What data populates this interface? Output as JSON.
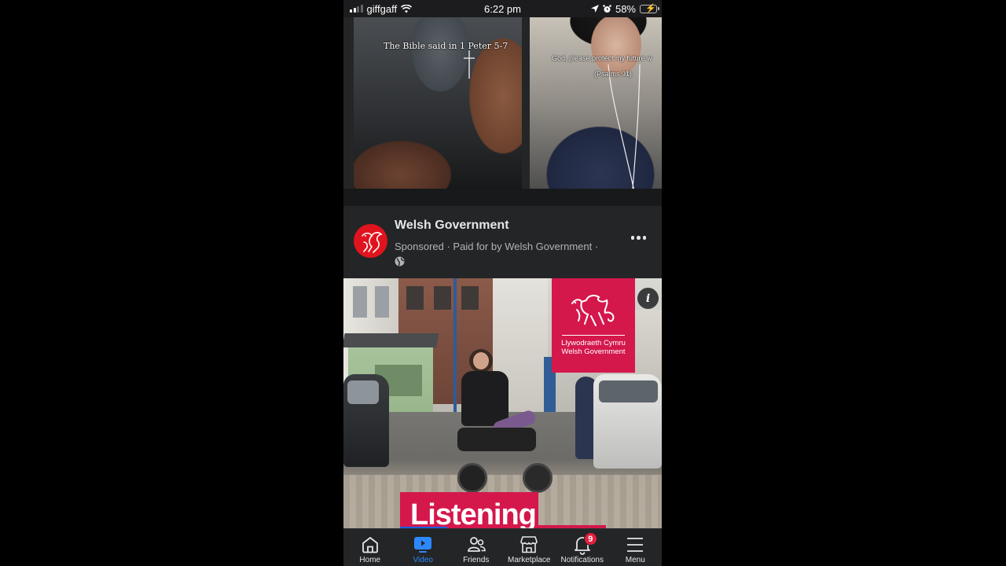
{
  "status_bar": {
    "carrier": "giffgaff",
    "time": "6:22 pm",
    "battery_percent": "58%",
    "battery_level": 0.58,
    "icons": [
      "signal-icon",
      "wifi-icon",
      "location-icon",
      "alarm-icon",
      "battery-charging-icon"
    ]
  },
  "reels": [
    {
      "caption": "The Bible said in 1 Peter 5-7"
    },
    {
      "caption": "God, please protect my future w",
      "subcaption": "(Psalms 91)"
    }
  ],
  "post": {
    "page_name": "Welsh Government",
    "meta": "Sponsored · Paid for by Welsh Government ·",
    "privacy_icon": "globe-icon",
    "more_icon": "more-horizontal-icon",
    "ad": {
      "logo_line1": "Llywodraeth Cymru",
      "logo_line2": "Welsh Government",
      "headline": "Listening",
      "info_icon": "info-icon"
    }
  },
  "tab_bar": {
    "active": "Video",
    "accent_color": "#2d88ff",
    "tabs": [
      {
        "label": "Home",
        "icon": "home-icon"
      },
      {
        "label": "Video",
        "icon": "video-icon"
      },
      {
        "label": "Friends",
        "icon": "friends-icon"
      },
      {
        "label": "Marketplace",
        "icon": "marketplace-icon"
      },
      {
        "label": "Notifications",
        "icon": "bell-icon",
        "badge": "9"
      },
      {
        "label": "Menu",
        "icon": "menu-icon"
      }
    ]
  }
}
